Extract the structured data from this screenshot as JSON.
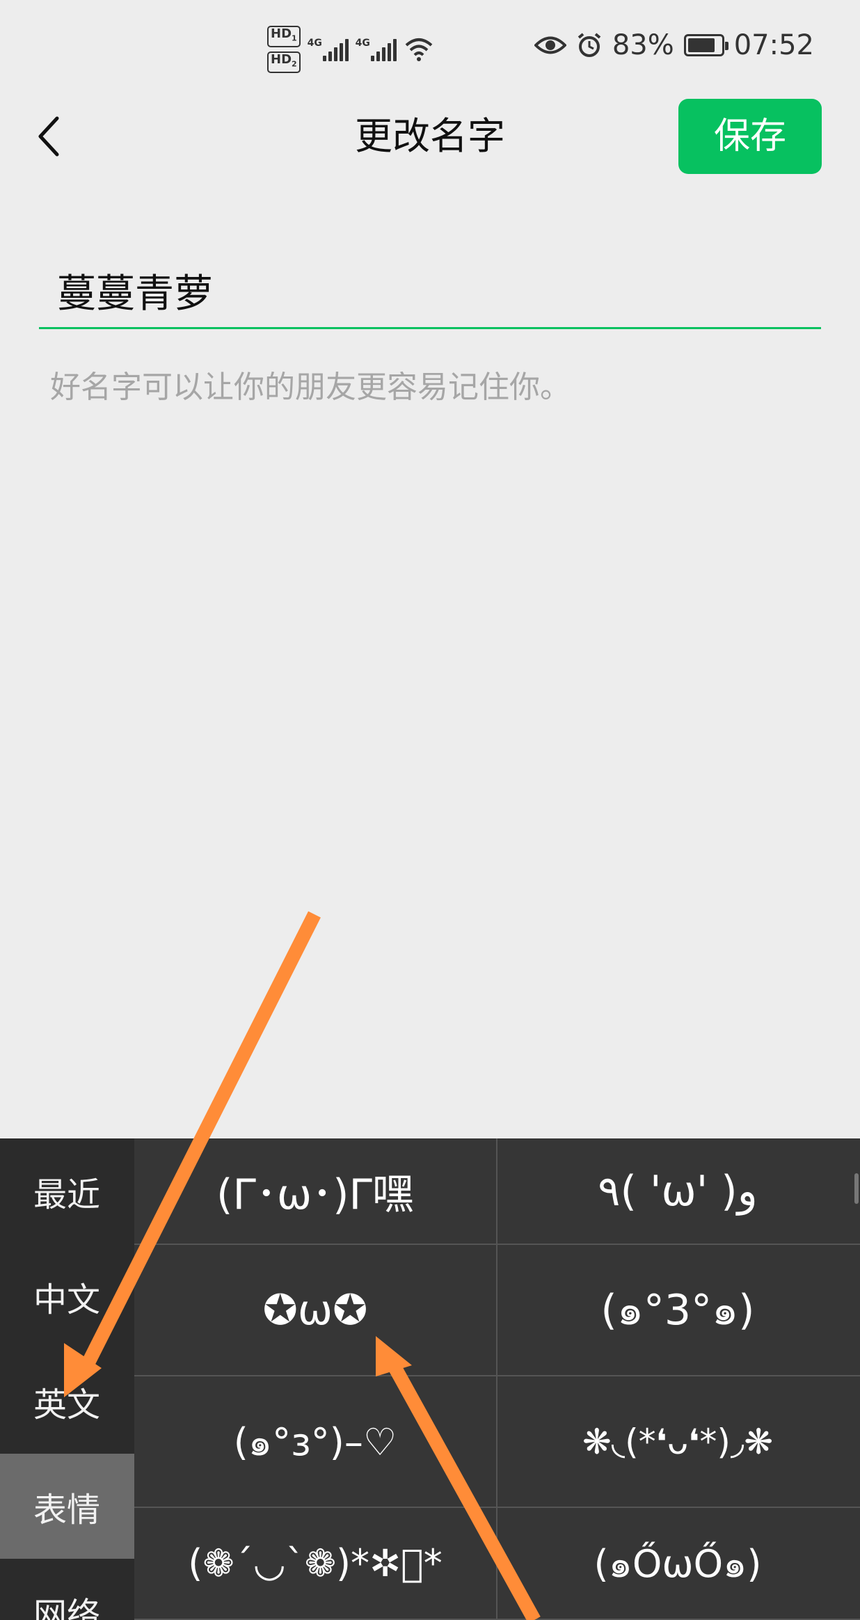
{
  "status_bar": {
    "sim1": "HD",
    "sim1_num": "1",
    "sim2": "HD",
    "sim2_num": "2",
    "network1": "4G",
    "network2": "4G",
    "battery_percent": "83%",
    "time": "07:52",
    "icons": [
      "eye-icon",
      "alarm-icon",
      "battery-icon",
      "wifi-icon",
      "signal-icon"
    ]
  },
  "nav": {
    "title": "更改名字",
    "save_label": "保存",
    "back_icon": "chevron-left-icon"
  },
  "form": {
    "name_value": "蔓蔓青萝",
    "hint": "好名字可以让你的朋友更容易记住你。"
  },
  "keyboard": {
    "categories": [
      {
        "label": "最近"
      },
      {
        "label": "中文"
      },
      {
        "label": "英文"
      },
      {
        "label": "表情"
      },
      {
        "label": "网络"
      }
    ],
    "active_category": "表情",
    "emoticons": [
      [
        "(Γ･ω･)Γ嘿",
        "٩( 'ω' )و"
      ],
      [
        "✪ω✪",
        "(๑°3°๑)"
      ],
      [
        "(๑°ɜ°)–♡",
        "❋◟(*❛ᴗ❛*)◞❋"
      ],
      [
        "(❁´◡`❁)*✲ﾟ*",
        "(๑ŐѡŐ๑)"
      ]
    ]
  },
  "colors": {
    "accent": "#07c160",
    "arrow": "#ff8c38",
    "keyboard_bg": "#2b2b2b",
    "page_bg": "#ededed"
  }
}
